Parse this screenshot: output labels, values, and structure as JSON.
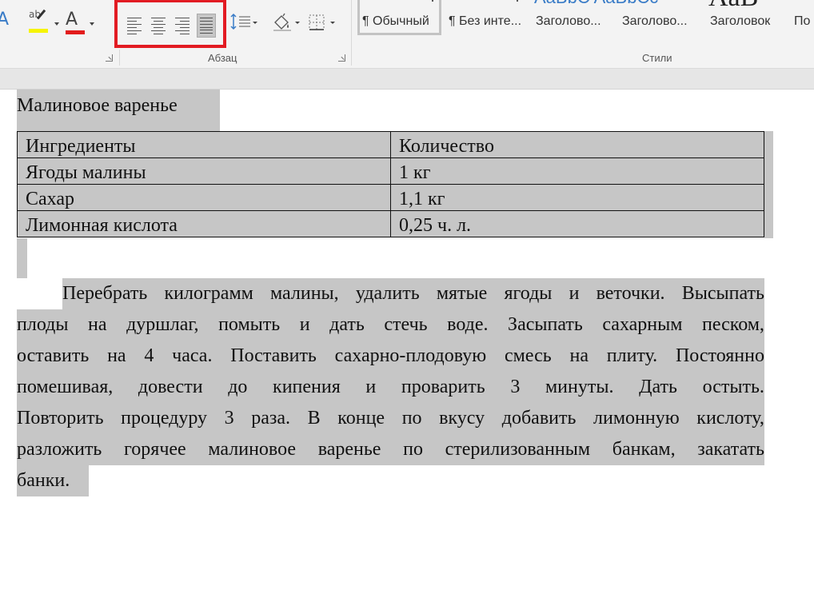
{
  "ribbon": {
    "font_group": {
      "text_effects_glyph": "A",
      "highlight_letters": "ab",
      "font_color_glyph": "A"
    },
    "paragraph_group": {
      "label": "Абзац",
      "align_buttons": [
        {
          "name": "align-left",
          "active": false
        },
        {
          "name": "align-center",
          "active": false
        },
        {
          "name": "align-right",
          "active": false
        },
        {
          "name": "justify",
          "active": true
        }
      ]
    },
    "styles_group": {
      "label": "Стили",
      "items": [
        "¶ Обычный",
        "¶ Без инте...",
        "Заголово...",
        "Заголово...",
        "Заголовок",
        "По"
      ],
      "selected_index": 0,
      "preview_blue": "AaBbC AaBbCc",
      "preview_black": "AaB"
    },
    "colors": {
      "highlight": "#f6f400",
      "font_color": "#e21b1b",
      "alignment_frame": "#e21b23"
    }
  },
  "document": {
    "title": "Малиновое варенье",
    "table": {
      "rows": [
        [
          "Ингредиенты",
          "Количество"
        ],
        [
          "Ягоды малины",
          "1 кг"
        ],
        [
          "Сахар",
          "1,1 кг"
        ],
        [
          "Лимонная кислота",
          "0,25 ч. л."
        ]
      ]
    },
    "paragraph_lines": [
      "Перебрать килограмм малины, удалить мятые ягоды и веточки. Высыпать",
      "плоды на дуршлаг, помыть и дать стечь воде. Засыпать сахарным песком,",
      "оставить на 4 часа. Поставить сахарно-плодовую смесь на плиту. Постоянно",
      "помешивая, довести до кипения и проварить 3 минуты. Дать остыть.",
      "Повторить процедуру 3 раза. В конце по вкусу добавить лимонную кислоту,",
      "разложить горячее малиновое варенье по стерилизованным банкам, закатать",
      "банки."
    ],
    "selection_color": "#c6c6c6"
  }
}
